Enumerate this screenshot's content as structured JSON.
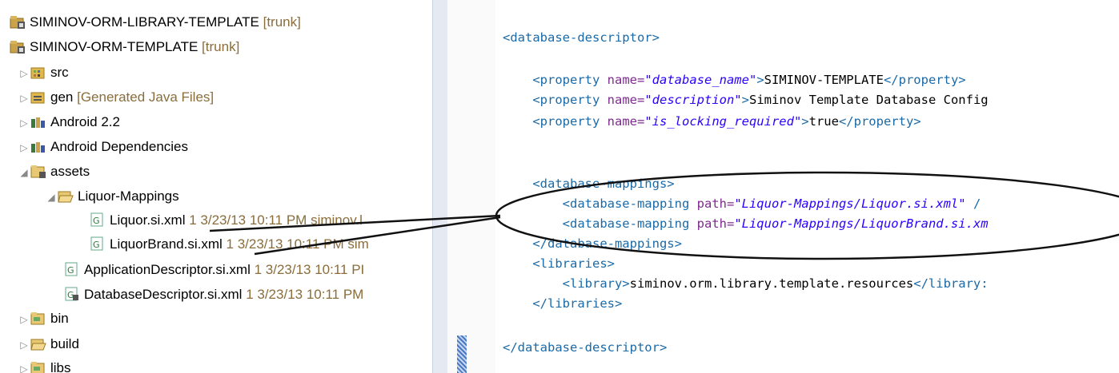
{
  "tree": {
    "projects": [
      {
        "name": "SIMINOV-ORM-LIBRARY-TEMPLATE",
        "decoration": "[trunk]"
      },
      {
        "name": "SIMINOV-ORM-TEMPLATE",
        "decoration": "[trunk]"
      }
    ],
    "items": {
      "src": {
        "label": "src"
      },
      "gen": {
        "label": "gen",
        "decoration": "[Generated Java Files]"
      },
      "android": {
        "label": "Android 2.2"
      },
      "android_deps": {
        "label": "Android Dependencies"
      },
      "assets": {
        "label": "assets"
      },
      "liquor_mappings": {
        "label": "Liquor-Mappings"
      },
      "liquor_xml": {
        "label": "Liquor.si.xml",
        "decoration": "1  3/23/13 10:11 PM  siminov.l"
      },
      "liquorbrand_xml": {
        "label": "LiquorBrand.si.xml",
        "decoration": "1  3/23/13 10:11 PM  sim"
      },
      "appdesc_xml": {
        "label": "ApplicationDescriptor.si.xml",
        "decoration": "1  3/23/13 10:11 PI"
      },
      "dbdesc_xml": {
        "label": "DatabaseDescriptor.si.xml",
        "decoration": "1  3/23/13 10:11 PM"
      },
      "bin": {
        "label": "bin"
      },
      "build": {
        "label": "build"
      },
      "libs": {
        "label": "libs"
      }
    }
  },
  "editor": {
    "l1_tag": "<database-descriptor>",
    "p1_open": "<property ",
    "p1_attr": "name=",
    "p1_val": "\"database_name\"",
    "p1_gt": ">",
    "p1_text": "SIMINOV-TEMPLATE",
    "p1_close": "</property>",
    "p2_open": "<property ",
    "p2_attr": "name=",
    "p2_val": "\"description\"",
    "p2_gt": ">",
    "p2_text": "Siminov Template Database Config",
    "p3_open": "<property ",
    "p3_attr": "name=",
    "p3_val": "\"is_locking_required\"",
    "p3_gt": ">",
    "p3_text": "true",
    "p3_close": "</property>",
    "dm_open": "<database-mappings>",
    "m1_open": "<database-mapping ",
    "m1_attr": "path=",
    "m1_val": "\"Liquor-Mappings/Liquor.si.xml\"",
    "m1_end": " /",
    "m2_open": "<database-mapping ",
    "m2_attr": "path=",
    "m2_val": "\"Liquor-Mappings/LiquorBrand.si.xm",
    "dm_close": "</database-mappings>",
    "lib_open": "<libraries>",
    "lib_item_open": "<library>",
    "lib_item_text": "siminov.orm.library.template.resources",
    "lib_item_close": "</library:",
    "lib_close": "</libraries>",
    "l_end": "</database-descriptor>"
  },
  "colors": {
    "tag": "#1a6aa8",
    "attr": "#7f2a8f",
    "string": "#2a00ff",
    "decoration": "#8a6d3b"
  }
}
